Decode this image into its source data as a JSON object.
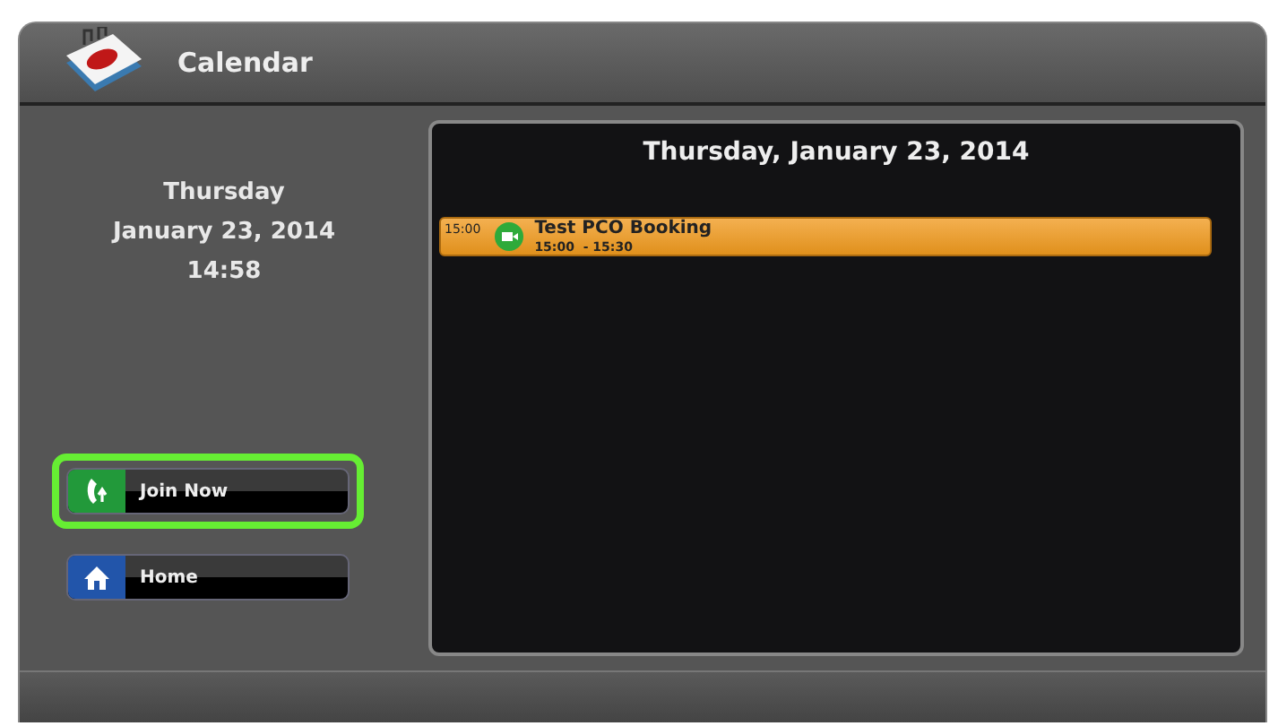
{
  "header": {
    "title": "Calendar"
  },
  "clock": {
    "weekday": "Thursday",
    "date": "January 23, 2014",
    "time": "14:58"
  },
  "buttons": [
    {
      "label": "Join Now",
      "kind": "phone",
      "focused": true
    },
    {
      "label": "Home",
      "kind": "home",
      "focused": false
    }
  ],
  "agenda": {
    "title": "Thursday, January 23, 2014",
    "events": [
      {
        "hour": "15:00",
        "title": "Test PCO Booking",
        "range": "15:00  - 15:30"
      }
    ]
  }
}
